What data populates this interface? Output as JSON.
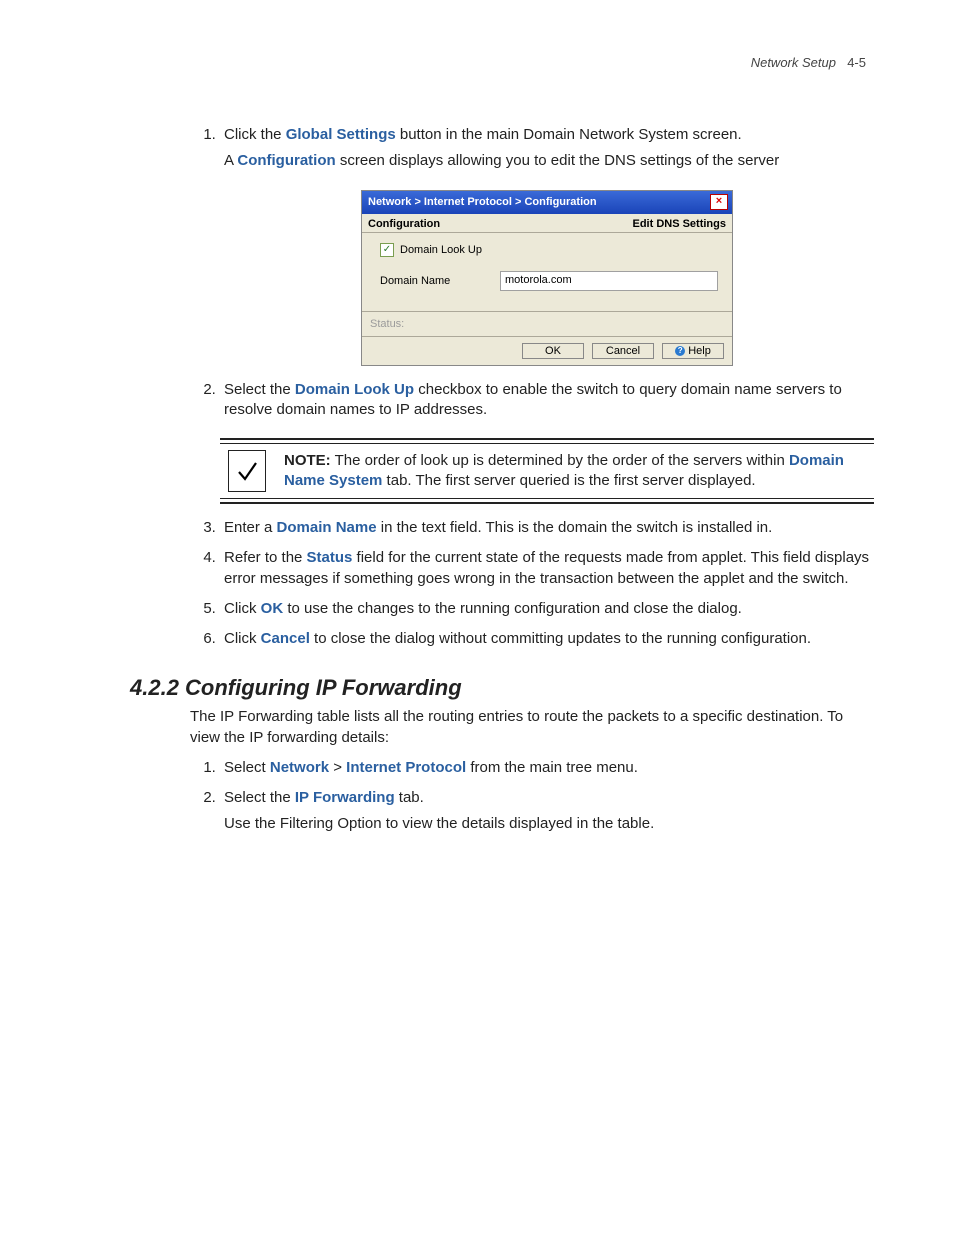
{
  "header": {
    "title": "Network Setup",
    "page": "4-5"
  },
  "steps1": {
    "s1a": "Click the ",
    "s1b": "Global Settings",
    "s1c": " button in the main Domain Network System screen.",
    "s1_indent_a": "A ",
    "s1_indent_b": "Configuration",
    "s1_indent_c": " screen displays allowing you to edit the DNS settings of the server",
    "s2a": "Select the ",
    "s2b": "Domain Look Up",
    "s2c": " checkbox to enable the switch to query domain name servers to resolve domain names to IP addresses.",
    "s3a": "Enter a ",
    "s3b": "Domain Name",
    "s3c": " in the text field. This is the domain the switch is installed in.",
    "s4a": "Refer to the ",
    "s4b": "Status",
    "s4c": " field for the current state of the requests made from applet. This field displays error messages if something goes wrong in the transaction between the applet and the switch.",
    "s5a": "Click ",
    "s5b": "OK",
    "s5c": " to use the changes to the running configuration and close the dialog.",
    "s6a": "Click ",
    "s6b": "Cancel",
    "s6c": " to close the dialog without committing updates to the running configuration."
  },
  "dialog": {
    "breadcrumb": "Network > Internet Protocol > Configuration",
    "left": "Configuration",
    "right": "Edit DNS Settings",
    "lookup": "Domain Look Up",
    "dname_label": "Domain Name",
    "dname_value": "motorola.com",
    "status": "Status:",
    "ok": "OK",
    "cancel": "Cancel",
    "help": "Help"
  },
  "note": {
    "label": "NOTE:",
    "t1": " The order of look up is determined by the order of the servers within ",
    "t2": "Domain Name System",
    "t3": " tab. The first server queried is the first server displayed."
  },
  "section": {
    "heading": "4.2.2  Configuring IP Forwarding",
    "p1": "The IP Forwarding table lists all the routing entries to route the packets to a specific destination. To view the IP forwarding details:",
    "s1a": "Select ",
    "s1b": "Network",
    "s1c": " > ",
    "s1d": "Internet Protocol",
    "s1e": " from the main tree menu.",
    "s2a": "Select the ",
    "s2b": "IP Forwarding",
    "s2c": " tab.",
    "s2_indent": "Use the Filtering Option to view the details displayed in the table."
  }
}
